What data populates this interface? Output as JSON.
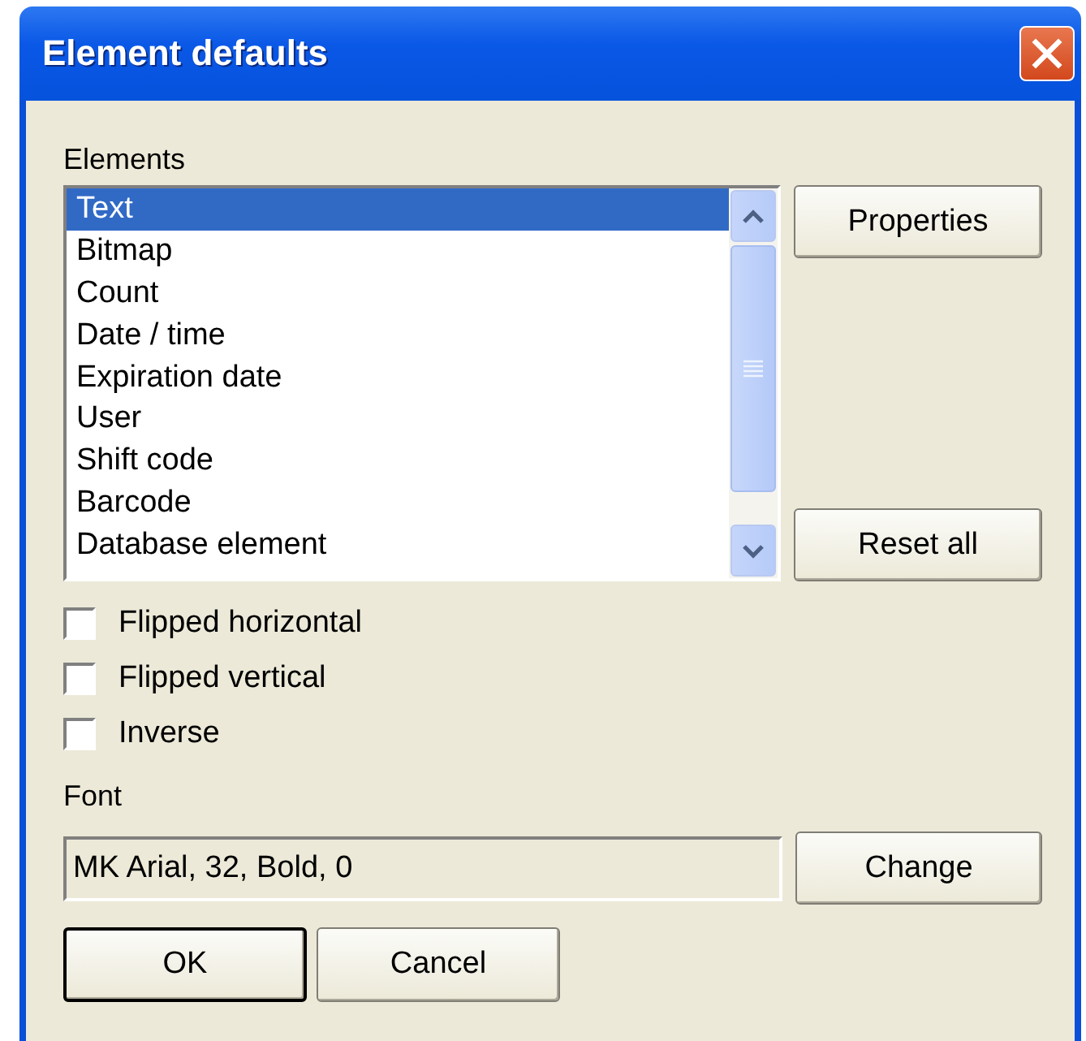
{
  "window": {
    "title": "Element defaults"
  },
  "elements_label": "Elements",
  "elements": [
    {
      "label": "Text",
      "selected": true
    },
    {
      "label": "Bitmap",
      "selected": false
    },
    {
      "label": "Count",
      "selected": false
    },
    {
      "label": "Date / time",
      "selected": false
    },
    {
      "label": "Expiration date",
      "selected": false
    },
    {
      "label": "User",
      "selected": false
    },
    {
      "label": "Shift code",
      "selected": false
    },
    {
      "label": "Barcode",
      "selected": false
    },
    {
      "label": "Database element",
      "selected": false
    }
  ],
  "properties_button": "Properties",
  "reset_button": "Reset all",
  "options": [
    {
      "label": "Flipped horizontal",
      "checked": false
    },
    {
      "label": "Flipped vertical",
      "checked": false
    },
    {
      "label": "Inverse",
      "checked": false
    }
  ],
  "font_label": "Font",
  "font_value": "MK Arial, 32, Bold, 0",
  "change_button": "Change",
  "buttons": [
    {
      "label": "OK",
      "default": true
    },
    {
      "label": "Cancel",
      "default": false
    }
  ]
}
